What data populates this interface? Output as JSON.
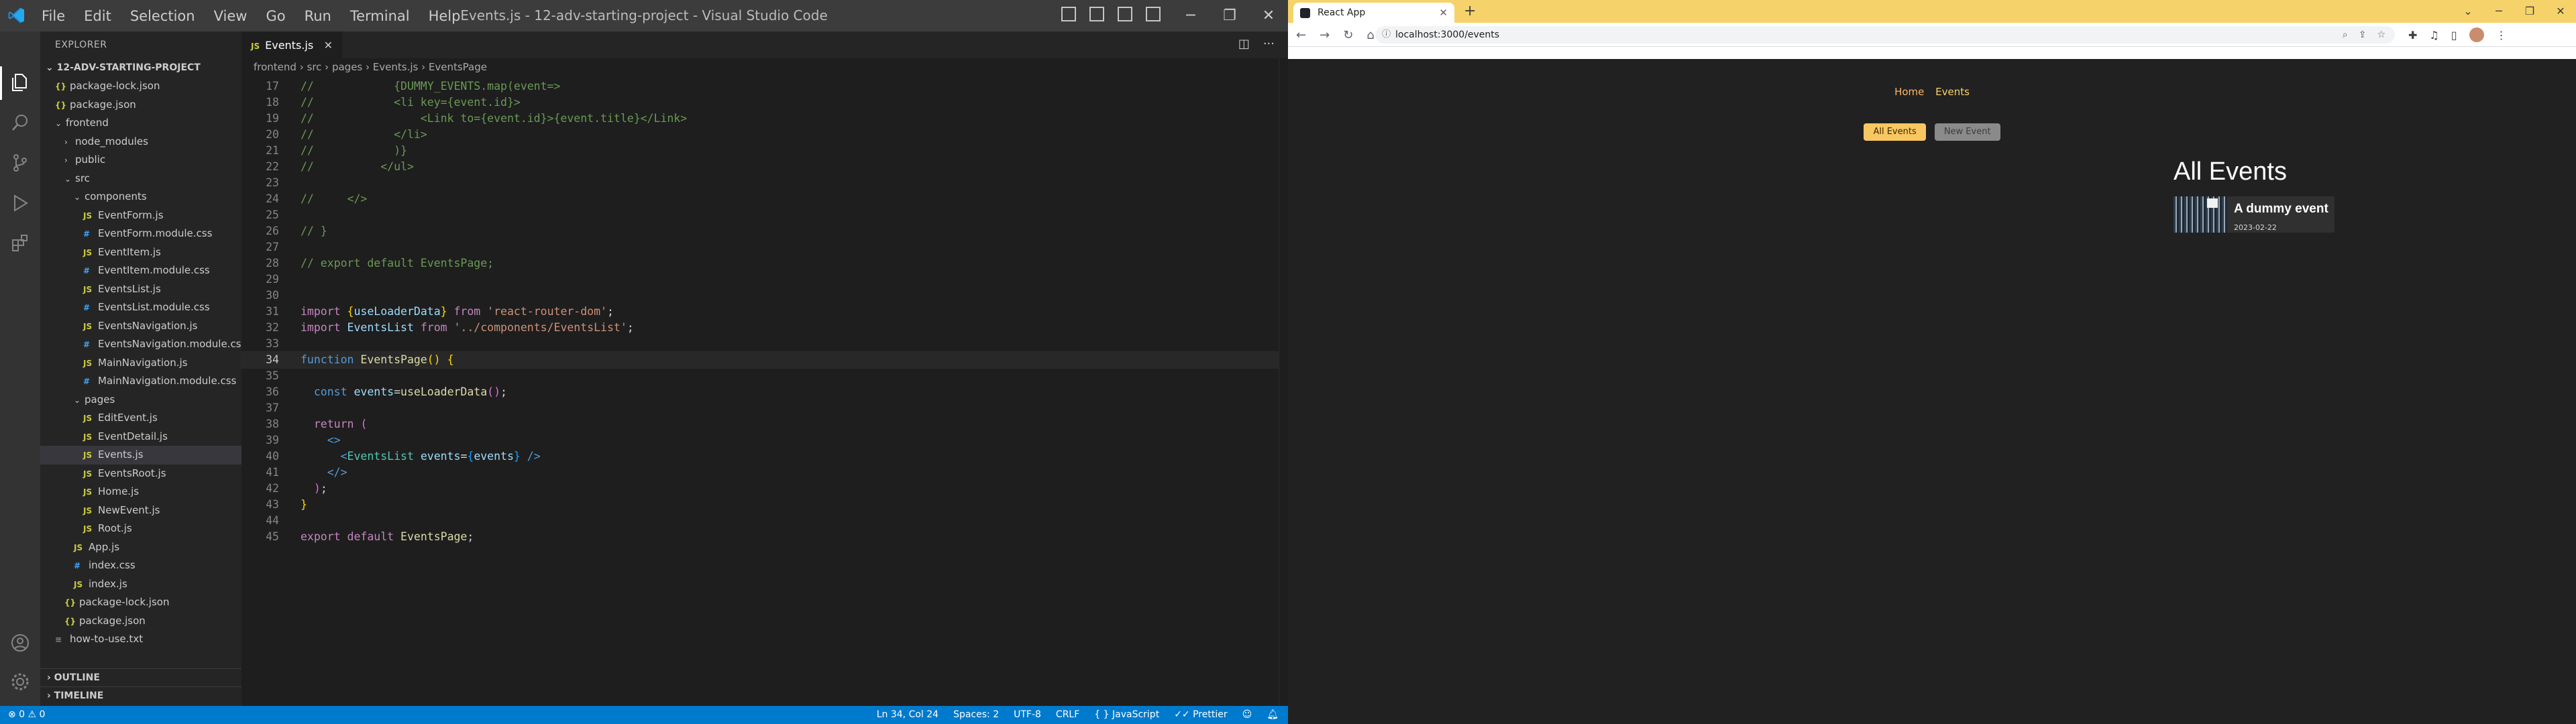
{
  "vscode": {
    "menu": [
      "File",
      "Edit",
      "Selection",
      "View",
      "Go",
      "Run",
      "Terminal",
      "Help"
    ],
    "window_title": "Events.js - 12-adv-starting-project - Visual Studio Code",
    "sidebar": {
      "title": "EXPLORER",
      "project": "12-ADV-STARTING-PROJECT",
      "tree": [
        {
          "label": "package-lock.json",
          "indent": 1,
          "kind": "json"
        },
        {
          "label": "package.json",
          "indent": 1,
          "kind": "json"
        },
        {
          "label": "frontend",
          "indent": 1,
          "kind": "folder-open"
        },
        {
          "label": "node_modules",
          "indent": 2,
          "kind": "folder"
        },
        {
          "label": "public",
          "indent": 2,
          "kind": "folder"
        },
        {
          "label": "src",
          "indent": 2,
          "kind": "folder-open"
        },
        {
          "label": "components",
          "indent": 3,
          "kind": "folder-open"
        },
        {
          "label": "EventForm.js",
          "indent": 4,
          "kind": "js"
        },
        {
          "label": "EventForm.module.css",
          "indent": 4,
          "kind": "css"
        },
        {
          "label": "EventItem.js",
          "indent": 4,
          "kind": "js"
        },
        {
          "label": "EventItem.module.css",
          "indent": 4,
          "kind": "css"
        },
        {
          "label": "EventsList.js",
          "indent": 4,
          "kind": "js"
        },
        {
          "label": "EventsList.module.css",
          "indent": 4,
          "kind": "css"
        },
        {
          "label": "EventsNavigation.js",
          "indent": 4,
          "kind": "js"
        },
        {
          "label": "EventsNavigation.module.css",
          "indent": 4,
          "kind": "css"
        },
        {
          "label": "MainNavigation.js",
          "indent": 4,
          "kind": "js"
        },
        {
          "label": "MainNavigation.module.css",
          "indent": 4,
          "kind": "css"
        },
        {
          "label": "pages",
          "indent": 3,
          "kind": "folder-open"
        },
        {
          "label": "EditEvent.js",
          "indent": 4,
          "kind": "js"
        },
        {
          "label": "EventDetail.js",
          "indent": 4,
          "kind": "js"
        },
        {
          "label": "Events.js",
          "indent": 4,
          "kind": "js",
          "selected": true
        },
        {
          "label": "EventsRoot.js",
          "indent": 4,
          "kind": "js"
        },
        {
          "label": "Home.js",
          "indent": 4,
          "kind": "js"
        },
        {
          "label": "NewEvent.js",
          "indent": 4,
          "kind": "js"
        },
        {
          "label": "Root.js",
          "indent": 4,
          "kind": "js"
        },
        {
          "label": "App.js",
          "indent": 3,
          "kind": "js"
        },
        {
          "label": "index.css",
          "indent": 3,
          "kind": "css"
        },
        {
          "label": "index.js",
          "indent": 3,
          "kind": "js"
        },
        {
          "label": "package-lock.json",
          "indent": 2,
          "kind": "json"
        },
        {
          "label": "package.json",
          "indent": 2,
          "kind": "json"
        },
        {
          "label": "how-to-use.txt",
          "indent": 1,
          "kind": "txt"
        }
      ],
      "outline": "OUTLINE",
      "timeline": "TIMELINE"
    },
    "tab": {
      "label": "Events.js",
      "file_badge": "JS"
    },
    "breadcrumb": [
      "frontend",
      "src",
      "pages",
      "Events.js",
      "EventsPage"
    ],
    "code_lines": [
      {
        "n": 17,
        "tokens": [
          [
            "c-com",
            "//            {DUMMY_EVENTS.map(event=>"
          ]
        ]
      },
      {
        "n": 18,
        "tokens": [
          [
            "c-com",
            "//            <li key={event.id}>"
          ]
        ]
      },
      {
        "n": 19,
        "tokens": [
          [
            "c-com",
            "//                <Link to={event.id}>{event.title}</Link>"
          ]
        ]
      },
      {
        "n": 20,
        "tokens": [
          [
            "c-com",
            "//            </li>"
          ]
        ]
      },
      {
        "n": 21,
        "tokens": [
          [
            "c-com",
            "//            )}"
          ]
        ]
      },
      {
        "n": 22,
        "tokens": [
          [
            "c-com",
            "//          </ul>"
          ]
        ]
      },
      {
        "n": 23,
        "tokens": []
      },
      {
        "n": 24,
        "tokens": [
          [
            "c-com",
            "//     </>"
          ]
        ]
      },
      {
        "n": 25,
        "tokens": []
      },
      {
        "n": 26,
        "tokens": [
          [
            "c-com",
            "// }"
          ]
        ]
      },
      {
        "n": 27,
        "tokens": []
      },
      {
        "n": 28,
        "tokens": [
          [
            "c-com",
            "// export default EventsPage;"
          ]
        ]
      },
      {
        "n": 29,
        "tokens": []
      },
      {
        "n": 30,
        "tokens": []
      },
      {
        "n": 31,
        "tokens": [
          [
            "c-kw",
            "import "
          ],
          [
            "c-brk",
            "{"
          ],
          [
            "c-var",
            "useLoaderData"
          ],
          [
            "c-brk",
            "}"
          ],
          [
            "c-kw",
            " from "
          ],
          [
            "c-str",
            "'react-router-dom'"
          ],
          [
            "c-pun",
            ";"
          ]
        ]
      },
      {
        "n": 32,
        "tokens": [
          [
            "c-kw",
            "import "
          ],
          [
            "c-var",
            "EventsList"
          ],
          [
            "c-kw",
            " from "
          ],
          [
            "c-str",
            "'../components/EventsList'"
          ],
          [
            "c-pun",
            ";"
          ]
        ]
      },
      {
        "n": 33,
        "tokens": []
      },
      {
        "n": 34,
        "current": true,
        "tokens": [
          [
            "c-kw2",
            "function "
          ],
          [
            "c-fn",
            "EventsPage"
          ],
          [
            "c-brk",
            "()"
          ],
          [
            "c-pun",
            " "
          ],
          [
            "c-brk",
            "{"
          ]
        ]
      },
      {
        "n": 35,
        "tokens": []
      },
      {
        "n": 36,
        "tokens": [
          [
            "c-pun",
            "  "
          ],
          [
            "c-kw2",
            "const "
          ],
          [
            "c-var",
            "events"
          ],
          [
            "c-pun",
            "="
          ],
          [
            "c-fn",
            "useLoaderData"
          ],
          [
            "c-brk2",
            "()"
          ],
          [
            "c-pun",
            ";"
          ]
        ]
      },
      {
        "n": 37,
        "tokens": []
      },
      {
        "n": 38,
        "tokens": [
          [
            "c-pun",
            "  "
          ],
          [
            "c-kw",
            "return "
          ],
          [
            "c-brk2",
            "("
          ]
        ]
      },
      {
        "n": 39,
        "tokens": [
          [
            "c-pun",
            "    "
          ],
          [
            "c-kw2",
            "<>"
          ]
        ]
      },
      {
        "n": 40,
        "tokens": [
          [
            "c-pun",
            "      "
          ],
          [
            "c-kw2",
            "<"
          ],
          [
            "c-tag",
            "EventsList"
          ],
          [
            "c-var",
            " events"
          ],
          [
            "c-pun",
            "="
          ],
          [
            "c-brk3",
            "{"
          ],
          [
            "c-var",
            "events"
          ],
          [
            "c-brk3",
            "}"
          ],
          [
            "c-kw2",
            " />"
          ]
        ]
      },
      {
        "n": 41,
        "tokens": [
          [
            "c-pun",
            "    "
          ],
          [
            "c-kw2",
            "</>"
          ]
        ]
      },
      {
        "n": 42,
        "tokens": [
          [
            "c-pun",
            "  "
          ],
          [
            "c-brk2",
            ")"
          ],
          [
            "c-pun",
            ";"
          ]
        ]
      },
      {
        "n": 43,
        "tokens": [
          [
            "c-brk",
            "}"
          ]
        ]
      },
      {
        "n": 44,
        "tokens": []
      },
      {
        "n": 45,
        "tokens": [
          [
            "c-kw",
            "export "
          ],
          [
            "c-kw",
            "default "
          ],
          [
            "c-fn",
            "EventsPage"
          ],
          [
            "c-pun",
            ";"
          ]
        ]
      }
    ],
    "status": {
      "left": "⊗ 0 ⚠ 0",
      "position": "Ln 34, Col 24",
      "spaces": "Spaces: 2",
      "encoding": "UTF-8",
      "eol": "CRLF",
      "language": "JavaScript",
      "formatter": "Prettier"
    }
  },
  "browser": {
    "tab_title": "React App",
    "url": "localhost:3000/events",
    "app": {
      "nav": [
        "Home",
        "Events"
      ],
      "event_nav": [
        "All Events",
        "New Event"
      ],
      "page_title": "All Events",
      "events": [
        {
          "title": "A dummy event",
          "date": "2023-02-22"
        }
      ]
    }
  }
}
